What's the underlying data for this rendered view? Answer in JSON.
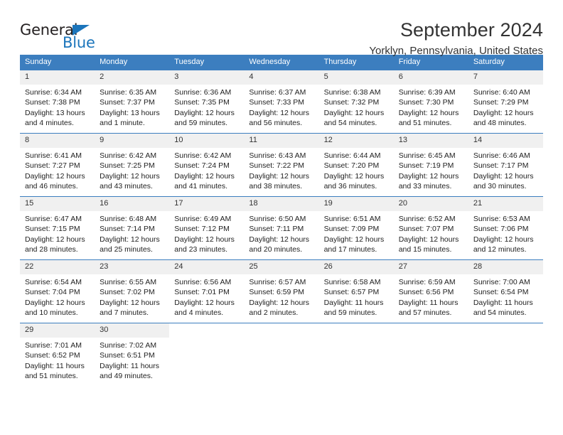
{
  "logo": {
    "word_top": "General",
    "word_bottom": "Blue",
    "accent_color": "#1b75bb"
  },
  "header": {
    "title": "September 2024",
    "subtitle": "Yorklyn, Pennsylvania, United States"
  },
  "calendar": {
    "header_color": "#3c7ebf",
    "daynum_bg": "#f0f0f0",
    "weekdays": [
      "Sunday",
      "Monday",
      "Tuesday",
      "Wednesday",
      "Thursday",
      "Friday",
      "Saturday"
    ],
    "weeks": [
      [
        {
          "day": "1",
          "sunrise": "Sunrise: 6:34 AM",
          "sunset": "Sunset: 7:38 PM",
          "daylight": "Daylight: 13 hours and 4 minutes."
        },
        {
          "day": "2",
          "sunrise": "Sunrise: 6:35 AM",
          "sunset": "Sunset: 7:37 PM",
          "daylight": "Daylight: 13 hours and 1 minute."
        },
        {
          "day": "3",
          "sunrise": "Sunrise: 6:36 AM",
          "sunset": "Sunset: 7:35 PM",
          "daylight": "Daylight: 12 hours and 59 minutes."
        },
        {
          "day": "4",
          "sunrise": "Sunrise: 6:37 AM",
          "sunset": "Sunset: 7:33 PM",
          "daylight": "Daylight: 12 hours and 56 minutes."
        },
        {
          "day": "5",
          "sunrise": "Sunrise: 6:38 AM",
          "sunset": "Sunset: 7:32 PM",
          "daylight": "Daylight: 12 hours and 54 minutes."
        },
        {
          "day": "6",
          "sunrise": "Sunrise: 6:39 AM",
          "sunset": "Sunset: 7:30 PM",
          "daylight": "Daylight: 12 hours and 51 minutes."
        },
        {
          "day": "7",
          "sunrise": "Sunrise: 6:40 AM",
          "sunset": "Sunset: 7:29 PM",
          "daylight": "Daylight: 12 hours and 48 minutes."
        }
      ],
      [
        {
          "day": "8",
          "sunrise": "Sunrise: 6:41 AM",
          "sunset": "Sunset: 7:27 PM",
          "daylight": "Daylight: 12 hours and 46 minutes."
        },
        {
          "day": "9",
          "sunrise": "Sunrise: 6:42 AM",
          "sunset": "Sunset: 7:25 PM",
          "daylight": "Daylight: 12 hours and 43 minutes."
        },
        {
          "day": "10",
          "sunrise": "Sunrise: 6:42 AM",
          "sunset": "Sunset: 7:24 PM",
          "daylight": "Daylight: 12 hours and 41 minutes."
        },
        {
          "day": "11",
          "sunrise": "Sunrise: 6:43 AM",
          "sunset": "Sunset: 7:22 PM",
          "daylight": "Daylight: 12 hours and 38 minutes."
        },
        {
          "day": "12",
          "sunrise": "Sunrise: 6:44 AM",
          "sunset": "Sunset: 7:20 PM",
          "daylight": "Daylight: 12 hours and 36 minutes."
        },
        {
          "day": "13",
          "sunrise": "Sunrise: 6:45 AM",
          "sunset": "Sunset: 7:19 PM",
          "daylight": "Daylight: 12 hours and 33 minutes."
        },
        {
          "day": "14",
          "sunrise": "Sunrise: 6:46 AM",
          "sunset": "Sunset: 7:17 PM",
          "daylight": "Daylight: 12 hours and 30 minutes."
        }
      ],
      [
        {
          "day": "15",
          "sunrise": "Sunrise: 6:47 AM",
          "sunset": "Sunset: 7:15 PM",
          "daylight": "Daylight: 12 hours and 28 minutes."
        },
        {
          "day": "16",
          "sunrise": "Sunrise: 6:48 AM",
          "sunset": "Sunset: 7:14 PM",
          "daylight": "Daylight: 12 hours and 25 minutes."
        },
        {
          "day": "17",
          "sunrise": "Sunrise: 6:49 AM",
          "sunset": "Sunset: 7:12 PM",
          "daylight": "Daylight: 12 hours and 23 minutes."
        },
        {
          "day": "18",
          "sunrise": "Sunrise: 6:50 AM",
          "sunset": "Sunset: 7:11 PM",
          "daylight": "Daylight: 12 hours and 20 minutes."
        },
        {
          "day": "19",
          "sunrise": "Sunrise: 6:51 AM",
          "sunset": "Sunset: 7:09 PM",
          "daylight": "Daylight: 12 hours and 17 minutes."
        },
        {
          "day": "20",
          "sunrise": "Sunrise: 6:52 AM",
          "sunset": "Sunset: 7:07 PM",
          "daylight": "Daylight: 12 hours and 15 minutes."
        },
        {
          "day": "21",
          "sunrise": "Sunrise: 6:53 AM",
          "sunset": "Sunset: 7:06 PM",
          "daylight": "Daylight: 12 hours and 12 minutes."
        }
      ],
      [
        {
          "day": "22",
          "sunrise": "Sunrise: 6:54 AM",
          "sunset": "Sunset: 7:04 PM",
          "daylight": "Daylight: 12 hours and 10 minutes."
        },
        {
          "day": "23",
          "sunrise": "Sunrise: 6:55 AM",
          "sunset": "Sunset: 7:02 PM",
          "daylight": "Daylight: 12 hours and 7 minutes."
        },
        {
          "day": "24",
          "sunrise": "Sunrise: 6:56 AM",
          "sunset": "Sunset: 7:01 PM",
          "daylight": "Daylight: 12 hours and 4 minutes."
        },
        {
          "day": "25",
          "sunrise": "Sunrise: 6:57 AM",
          "sunset": "Sunset: 6:59 PM",
          "daylight": "Daylight: 12 hours and 2 minutes."
        },
        {
          "day": "26",
          "sunrise": "Sunrise: 6:58 AM",
          "sunset": "Sunset: 6:57 PM",
          "daylight": "Daylight: 11 hours and 59 minutes."
        },
        {
          "day": "27",
          "sunrise": "Sunrise: 6:59 AM",
          "sunset": "Sunset: 6:56 PM",
          "daylight": "Daylight: 11 hours and 57 minutes."
        },
        {
          "day": "28",
          "sunrise": "Sunrise: 7:00 AM",
          "sunset": "Sunset: 6:54 PM",
          "daylight": "Daylight: 11 hours and 54 minutes."
        }
      ],
      [
        {
          "day": "29",
          "sunrise": "Sunrise: 7:01 AM",
          "sunset": "Sunset: 6:52 PM",
          "daylight": "Daylight: 11 hours and 51 minutes."
        },
        {
          "day": "30",
          "sunrise": "Sunrise: 7:02 AM",
          "sunset": "Sunset: 6:51 PM",
          "daylight": "Daylight: 11 hours and 49 minutes."
        },
        {
          "day": "",
          "sunrise": "",
          "sunset": "",
          "daylight": ""
        },
        {
          "day": "",
          "sunrise": "",
          "sunset": "",
          "daylight": ""
        },
        {
          "day": "",
          "sunrise": "",
          "sunset": "",
          "daylight": ""
        },
        {
          "day": "",
          "sunrise": "",
          "sunset": "",
          "daylight": ""
        },
        {
          "day": "",
          "sunrise": "",
          "sunset": "",
          "daylight": ""
        }
      ]
    ]
  }
}
